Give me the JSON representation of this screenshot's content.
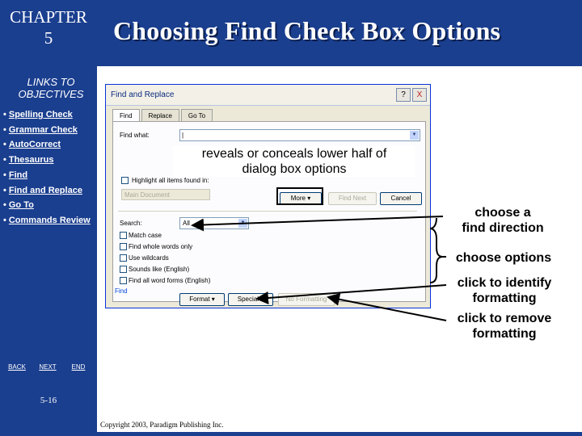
{
  "sidebar": {
    "chapter_line1": "CHAPTER",
    "chapter_line2": "5",
    "links_title_line1": "LINKS TO",
    "links_title_line2": "OBJECTIVES",
    "objectives": [
      {
        "label": "Spelling Check"
      },
      {
        "label": "Grammar Check"
      },
      {
        "label": "AutoCorrect"
      },
      {
        "label": "Thesaurus"
      },
      {
        "label": "Find"
      },
      {
        "label": "Find and Replace"
      },
      {
        "label": "Go To"
      },
      {
        "label": "Commands Review"
      }
    ],
    "nav": {
      "back": "BACK",
      "next": "NEXT",
      "end": "END"
    },
    "page_number": "5-16"
  },
  "header": {
    "title": "Choosing Find Check Box Options"
  },
  "footer": {
    "copyright": "Copyright 2003, Paradigm Publishing Inc."
  },
  "dialog": {
    "title": "Find and Replace",
    "controls": {
      "help": "?",
      "close": "X"
    },
    "tabs": [
      "Find",
      "Replace",
      "Go To"
    ],
    "find_what_label": "Find what:",
    "find_what_value": "|",
    "highlight_label": "Highlight all items found in:",
    "highlight_scope": "Main Document",
    "buttons": {
      "less": "More ▾",
      "find_next": "Find Next",
      "cancel": "Cancel"
    },
    "search_label": "Search:",
    "search_value": "All",
    "options": [
      "Match case",
      "Find whole words only",
      "Use wildcards",
      "Sounds like (English)",
      "Find all word forms (English)"
    ],
    "find_section_label": "Find",
    "bottom_buttons": {
      "format": "Format ▾",
      "special": "Special ▾",
      "no_formatting": "No Formatting"
    }
  },
  "callouts": {
    "reveal": [
      "reveals or conceals lower half of",
      "dialog box options"
    ],
    "direction": [
      "choose a",
      "find direction"
    ],
    "options": "choose options",
    "identify": [
      "click to identify",
      "formatting"
    ],
    "remove": [
      "click to remove",
      "formatting"
    ]
  },
  "colors": {
    "brand_blue": "#1b3f8f",
    "dialog_bg": "#ece9d8",
    "title_blue": "#0831d9"
  }
}
